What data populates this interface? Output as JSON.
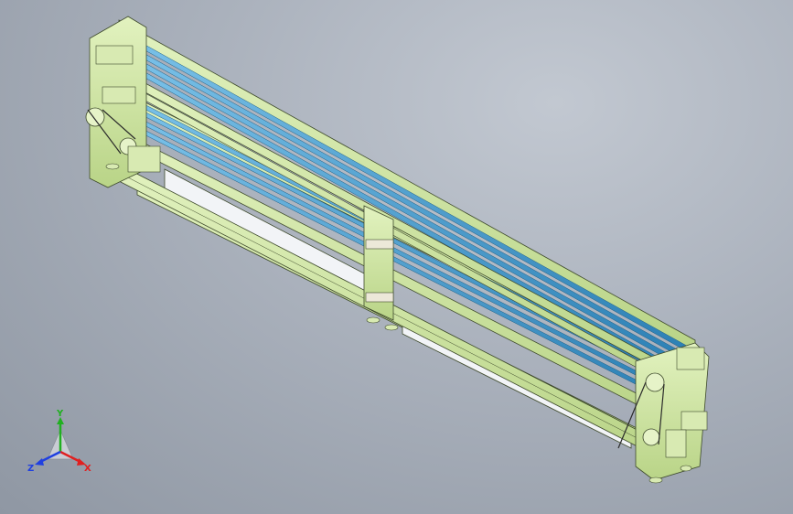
{
  "colors": {
    "background_light": "#c2c8d1",
    "background_dark": "#8f97a3",
    "frame": "#cfe6a3",
    "frame_edge": "#3e4a2c",
    "belt": "#4aa3d6",
    "belt_dark": "#1e5f86",
    "window": "#f2f4f7",
    "axis_x": "#e02020",
    "axis_y": "#20b020",
    "axis_z": "#2040e0"
  },
  "triad": {
    "x_label": "X",
    "y_label": "Y",
    "z_label": "Z"
  }
}
